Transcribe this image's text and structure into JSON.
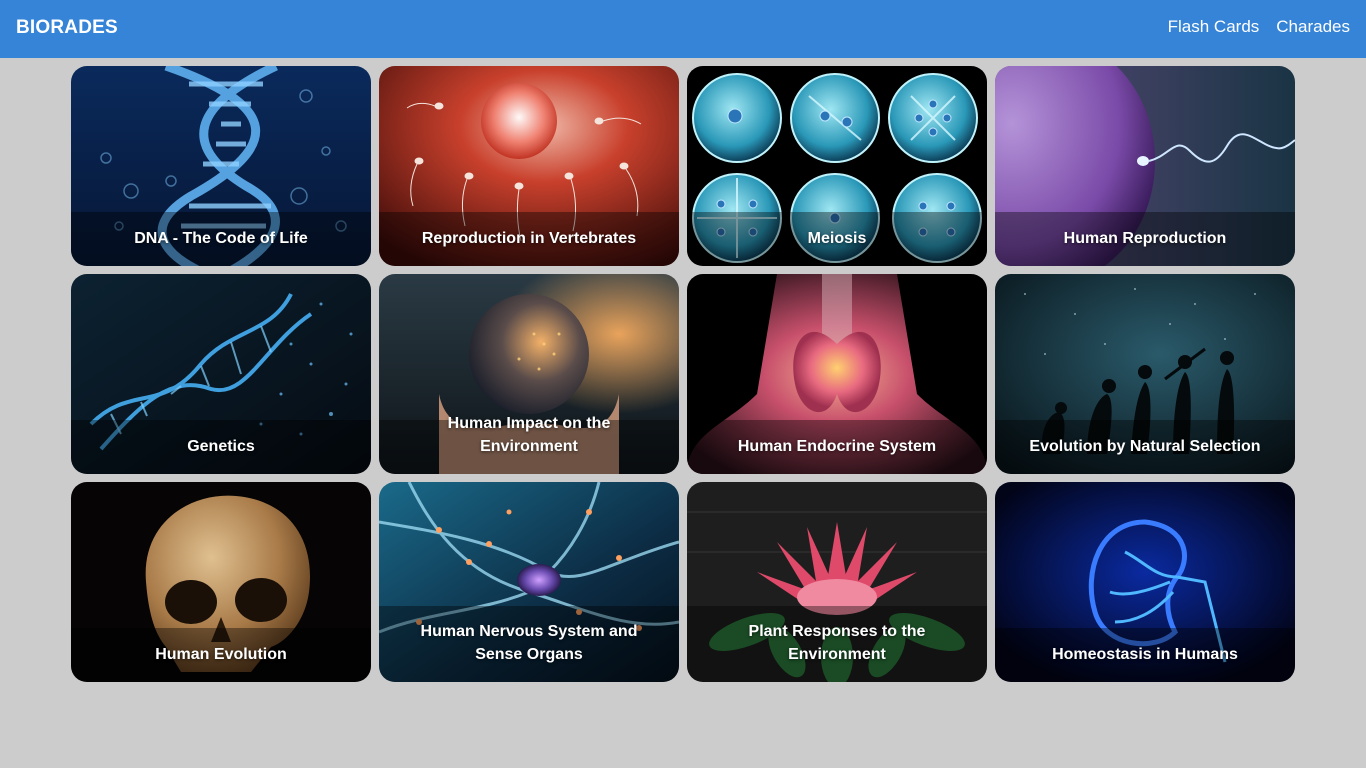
{
  "header": {
    "brand": "BIORADES",
    "nav": {
      "flash_cards": "Flash Cards",
      "charades": "Charades"
    },
    "color": "#3584d8"
  },
  "page": {
    "background": "#cccccc"
  },
  "cards": [
    {
      "title": "DNA - The Code of Life",
      "icon": "dna-helix-image"
    },
    {
      "title": "Reproduction in Vertebrates",
      "icon": "egg-and-sperm-image"
    },
    {
      "title": "Meiosis",
      "icon": "cell-division-image"
    },
    {
      "title": "Human Reproduction",
      "icon": "ovum-and-sperm-image"
    },
    {
      "title": "Genetics",
      "icon": "particle-helix-image"
    },
    {
      "title": "Human Impact on the Environment",
      "icon": "earth-in-hands-image"
    },
    {
      "title": "Human Endocrine System",
      "icon": "thyroid-image"
    },
    {
      "title": "Evolution by Natural Selection",
      "icon": "evolution-silhouettes-image"
    },
    {
      "title": "Human Evolution",
      "icon": "fossil-skull-image"
    },
    {
      "title": "Human Nervous System and Sense Organs",
      "icon": "neurons-image"
    },
    {
      "title": "Plant Responses to the Environment",
      "icon": "protea-flower-image"
    },
    {
      "title": "Homeostasis in Humans",
      "icon": "kidney-image"
    }
  ]
}
